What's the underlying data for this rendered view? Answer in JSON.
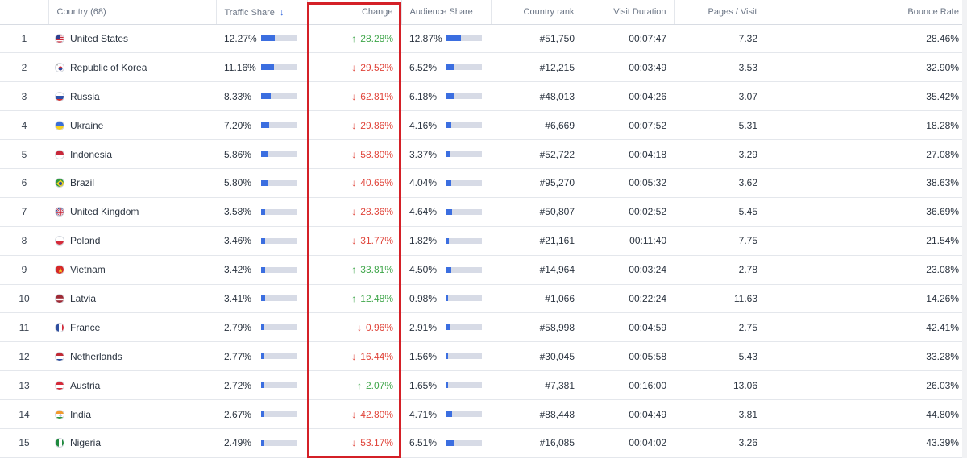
{
  "headers": {
    "num": "",
    "country": "Country (68)",
    "traffic_share": "Traffic Share",
    "change": "Change",
    "audience_share": "Audience Share",
    "country_rank": "Country rank",
    "visit_duration": "Visit Duration",
    "pages_visit": "Pages / Visit",
    "bounce_rate": "Bounce Rate"
  },
  "colors": {
    "accent": "#3b6ee0",
    "up": "#3fa64a",
    "down": "#e0443a",
    "highlight": "#d42027"
  },
  "rows": [
    {
      "num": "1",
      "country": "United States",
      "flag": "us",
      "traffic": "12.27%",
      "traffic_pct": 12.27,
      "dir": "up",
      "change": "28.28%",
      "audience": "12.87%",
      "audience_pct": 12.87,
      "rank": "#51,750",
      "duration": "00:07:47",
      "pages": "7.32",
      "bounce": "28.46%"
    },
    {
      "num": "2",
      "country": "Republic of Korea",
      "flag": "kr",
      "traffic": "11.16%",
      "traffic_pct": 11.16,
      "dir": "down",
      "change": "29.52%",
      "audience": "6.52%",
      "audience_pct": 6.52,
      "rank": "#12,215",
      "duration": "00:03:49",
      "pages": "3.53",
      "bounce": "32.90%"
    },
    {
      "num": "3",
      "country": "Russia",
      "flag": "ru",
      "traffic": "8.33%",
      "traffic_pct": 8.33,
      "dir": "down",
      "change": "62.81%",
      "audience": "6.18%",
      "audience_pct": 6.18,
      "rank": "#48,013",
      "duration": "00:04:26",
      "pages": "3.07",
      "bounce": "35.42%"
    },
    {
      "num": "4",
      "country": "Ukraine",
      "flag": "ua",
      "traffic": "7.20%",
      "traffic_pct": 7.2,
      "dir": "down",
      "change": "29.86%",
      "audience": "4.16%",
      "audience_pct": 4.16,
      "rank": "#6,669",
      "duration": "00:07:52",
      "pages": "5.31",
      "bounce": "18.28%"
    },
    {
      "num": "5",
      "country": "Indonesia",
      "flag": "id",
      "traffic": "5.86%",
      "traffic_pct": 5.86,
      "dir": "down",
      "change": "58.80%",
      "audience": "3.37%",
      "audience_pct": 3.37,
      "rank": "#52,722",
      "duration": "00:04:18",
      "pages": "3.29",
      "bounce": "27.08%"
    },
    {
      "num": "6",
      "country": "Brazil",
      "flag": "br",
      "traffic": "5.80%",
      "traffic_pct": 5.8,
      "dir": "down",
      "change": "40.65%",
      "audience": "4.04%",
      "audience_pct": 4.04,
      "rank": "#95,270",
      "duration": "00:05:32",
      "pages": "3.62",
      "bounce": "38.63%"
    },
    {
      "num": "7",
      "country": "United Kingdom",
      "flag": "gb",
      "traffic": "3.58%",
      "traffic_pct": 3.58,
      "dir": "down",
      "change": "28.36%",
      "audience": "4.64%",
      "audience_pct": 4.64,
      "rank": "#50,807",
      "duration": "00:02:52",
      "pages": "5.45",
      "bounce": "36.69%"
    },
    {
      "num": "8",
      "country": "Poland",
      "flag": "pl",
      "traffic": "3.46%",
      "traffic_pct": 3.46,
      "dir": "down",
      "change": "31.77%",
      "audience": "1.82%",
      "audience_pct": 1.82,
      "rank": "#21,161",
      "duration": "00:11:40",
      "pages": "7.75",
      "bounce": "21.54%"
    },
    {
      "num": "9",
      "country": "Vietnam",
      "flag": "vn",
      "traffic": "3.42%",
      "traffic_pct": 3.42,
      "dir": "up",
      "change": "33.81%",
      "audience": "4.50%",
      "audience_pct": 4.5,
      "rank": "#14,964",
      "duration": "00:03:24",
      "pages": "2.78",
      "bounce": "23.08%"
    },
    {
      "num": "10",
      "country": "Latvia",
      "flag": "lv",
      "traffic": "3.41%",
      "traffic_pct": 3.41,
      "dir": "up",
      "change": "12.48%",
      "audience": "0.98%",
      "audience_pct": 0.98,
      "rank": "#1,066",
      "duration": "00:22:24",
      "pages": "11.63",
      "bounce": "14.26%"
    },
    {
      "num": "11",
      "country": "France",
      "flag": "fr",
      "traffic": "2.79%",
      "traffic_pct": 2.79,
      "dir": "down",
      "change": "0.96%",
      "audience": "2.91%",
      "audience_pct": 2.91,
      "rank": "#58,998",
      "duration": "00:04:59",
      "pages": "2.75",
      "bounce": "42.41%"
    },
    {
      "num": "12",
      "country": "Netherlands",
      "flag": "nl",
      "traffic": "2.77%",
      "traffic_pct": 2.77,
      "dir": "down",
      "change": "16.44%",
      "audience": "1.56%",
      "audience_pct": 1.56,
      "rank": "#30,045",
      "duration": "00:05:58",
      "pages": "5.43",
      "bounce": "33.28%"
    },
    {
      "num": "13",
      "country": "Austria",
      "flag": "at",
      "traffic": "2.72%",
      "traffic_pct": 2.72,
      "dir": "up",
      "change": "2.07%",
      "audience": "1.65%",
      "audience_pct": 1.65,
      "rank": "#7,381",
      "duration": "00:16:00",
      "pages": "13.06",
      "bounce": "26.03%"
    },
    {
      "num": "14",
      "country": "India",
      "flag": "in",
      "traffic": "2.67%",
      "traffic_pct": 2.67,
      "dir": "down",
      "change": "42.80%",
      "audience": "4.71%",
      "audience_pct": 4.71,
      "rank": "#88,448",
      "duration": "00:04:49",
      "pages": "3.81",
      "bounce": "44.80%"
    },
    {
      "num": "15",
      "country": "Nigeria",
      "flag": "ng",
      "traffic": "2.49%",
      "traffic_pct": 2.49,
      "dir": "down",
      "change": "53.17%",
      "audience": "6.51%",
      "audience_pct": 6.51,
      "rank": "#16,085",
      "duration": "00:04:02",
      "pages": "3.26",
      "bounce": "43.39%"
    }
  ]
}
